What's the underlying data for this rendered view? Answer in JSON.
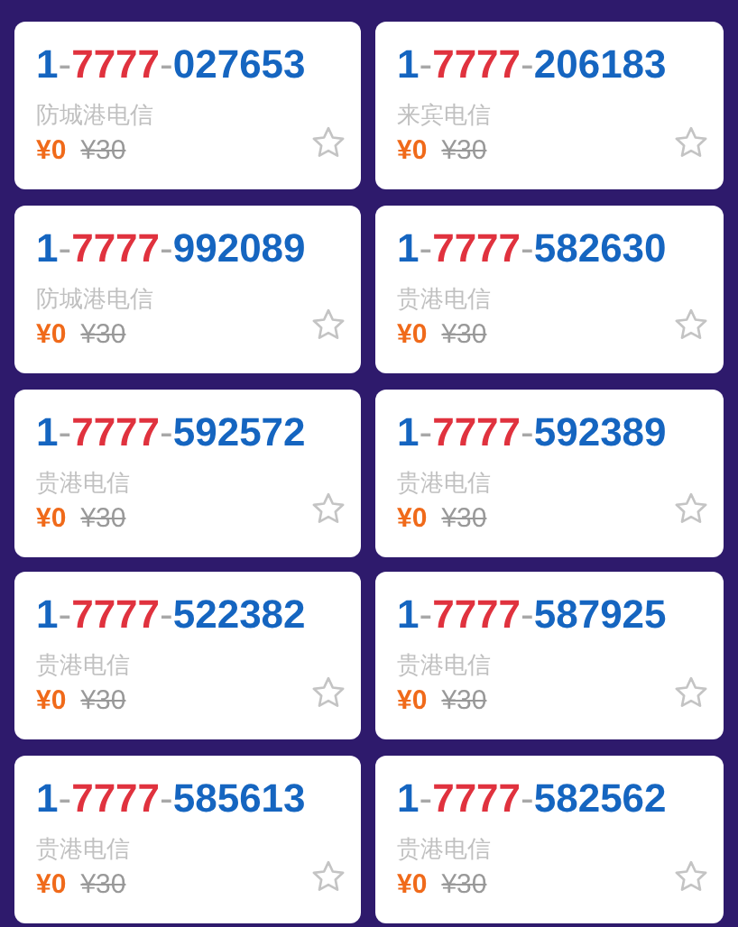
{
  "cards": [
    {
      "number": [
        {
          "kind": "lead",
          "text": "1"
        },
        {
          "kind": "sep",
          "text": "-"
        },
        {
          "kind": "lucky",
          "text": "7777"
        },
        {
          "kind": "sep",
          "text": "-"
        },
        {
          "kind": "tail",
          "text": "027653"
        }
      ],
      "region": "防城港电信",
      "price": "¥0",
      "old_price": "¥30",
      "starred": false
    },
    {
      "number": [
        {
          "kind": "lead",
          "text": "1"
        },
        {
          "kind": "sep",
          "text": "-"
        },
        {
          "kind": "lucky",
          "text": "7777"
        },
        {
          "kind": "sep",
          "text": "-"
        },
        {
          "kind": "tail",
          "text": "206183"
        }
      ],
      "region": "来宾电信",
      "price": "¥0",
      "old_price": "¥30",
      "starred": false
    },
    {
      "number": [
        {
          "kind": "lead",
          "text": "1"
        },
        {
          "kind": "sep",
          "text": "-"
        },
        {
          "kind": "lucky",
          "text": "7777"
        },
        {
          "kind": "sep",
          "text": "-"
        },
        {
          "kind": "tail",
          "text": "992089"
        }
      ],
      "region": "防城港电信",
      "price": "¥0",
      "old_price": "¥30",
      "starred": false
    },
    {
      "number": [
        {
          "kind": "lead",
          "text": "1"
        },
        {
          "kind": "sep",
          "text": "-"
        },
        {
          "kind": "lucky",
          "text": "7777"
        },
        {
          "kind": "sep",
          "text": "-"
        },
        {
          "kind": "tail",
          "text": "582630"
        }
      ],
      "region": "贵港电信",
      "price": "¥0",
      "old_price": "¥30",
      "starred": false
    },
    {
      "number": [
        {
          "kind": "lead",
          "text": "1"
        },
        {
          "kind": "sep",
          "text": "-"
        },
        {
          "kind": "lucky",
          "text": "7777"
        },
        {
          "kind": "sep",
          "text": "-"
        },
        {
          "kind": "tail",
          "text": "592572"
        }
      ],
      "region": "贵港电信",
      "price": "¥0",
      "old_price": "¥30",
      "starred": false
    },
    {
      "number": [
        {
          "kind": "lead",
          "text": "1"
        },
        {
          "kind": "sep",
          "text": "-"
        },
        {
          "kind": "lucky",
          "text": "7777"
        },
        {
          "kind": "sep",
          "text": "-"
        },
        {
          "kind": "tail",
          "text": "592389"
        }
      ],
      "region": "贵港电信",
      "price": "¥0",
      "old_price": "¥30",
      "starred": false
    },
    {
      "number": [
        {
          "kind": "lead",
          "text": "1"
        },
        {
          "kind": "sep",
          "text": "-"
        },
        {
          "kind": "lucky",
          "text": "7777"
        },
        {
          "kind": "sep",
          "text": "-"
        },
        {
          "kind": "tail",
          "text": "522382"
        }
      ],
      "region": "贵港电信",
      "price": "¥0",
      "old_price": "¥30",
      "starred": false
    },
    {
      "number": [
        {
          "kind": "lead",
          "text": "1"
        },
        {
          "kind": "sep",
          "text": "-"
        },
        {
          "kind": "lucky",
          "text": "7777"
        },
        {
          "kind": "sep",
          "text": "-"
        },
        {
          "kind": "tail",
          "text": "587925"
        }
      ],
      "region": "贵港电信",
      "price": "¥0",
      "old_price": "¥30",
      "starred": false
    },
    {
      "number": [
        {
          "kind": "lead",
          "text": "1"
        },
        {
          "kind": "sep",
          "text": "-"
        },
        {
          "kind": "lucky",
          "text": "7777"
        },
        {
          "kind": "sep",
          "text": "-"
        },
        {
          "kind": "tail",
          "text": "585613"
        }
      ],
      "region": "贵港电信",
      "price": "¥0",
      "old_price": "¥30",
      "starred": false
    },
    {
      "number": [
        {
          "kind": "lead",
          "text": "1"
        },
        {
          "kind": "sep",
          "text": "-"
        },
        {
          "kind": "lucky",
          "text": "7777"
        },
        {
          "kind": "sep",
          "text": "-"
        },
        {
          "kind": "tail",
          "text": "582562"
        }
      ],
      "region": "贵港电信",
      "price": "¥0",
      "old_price": "¥30",
      "starred": false
    }
  ]
}
